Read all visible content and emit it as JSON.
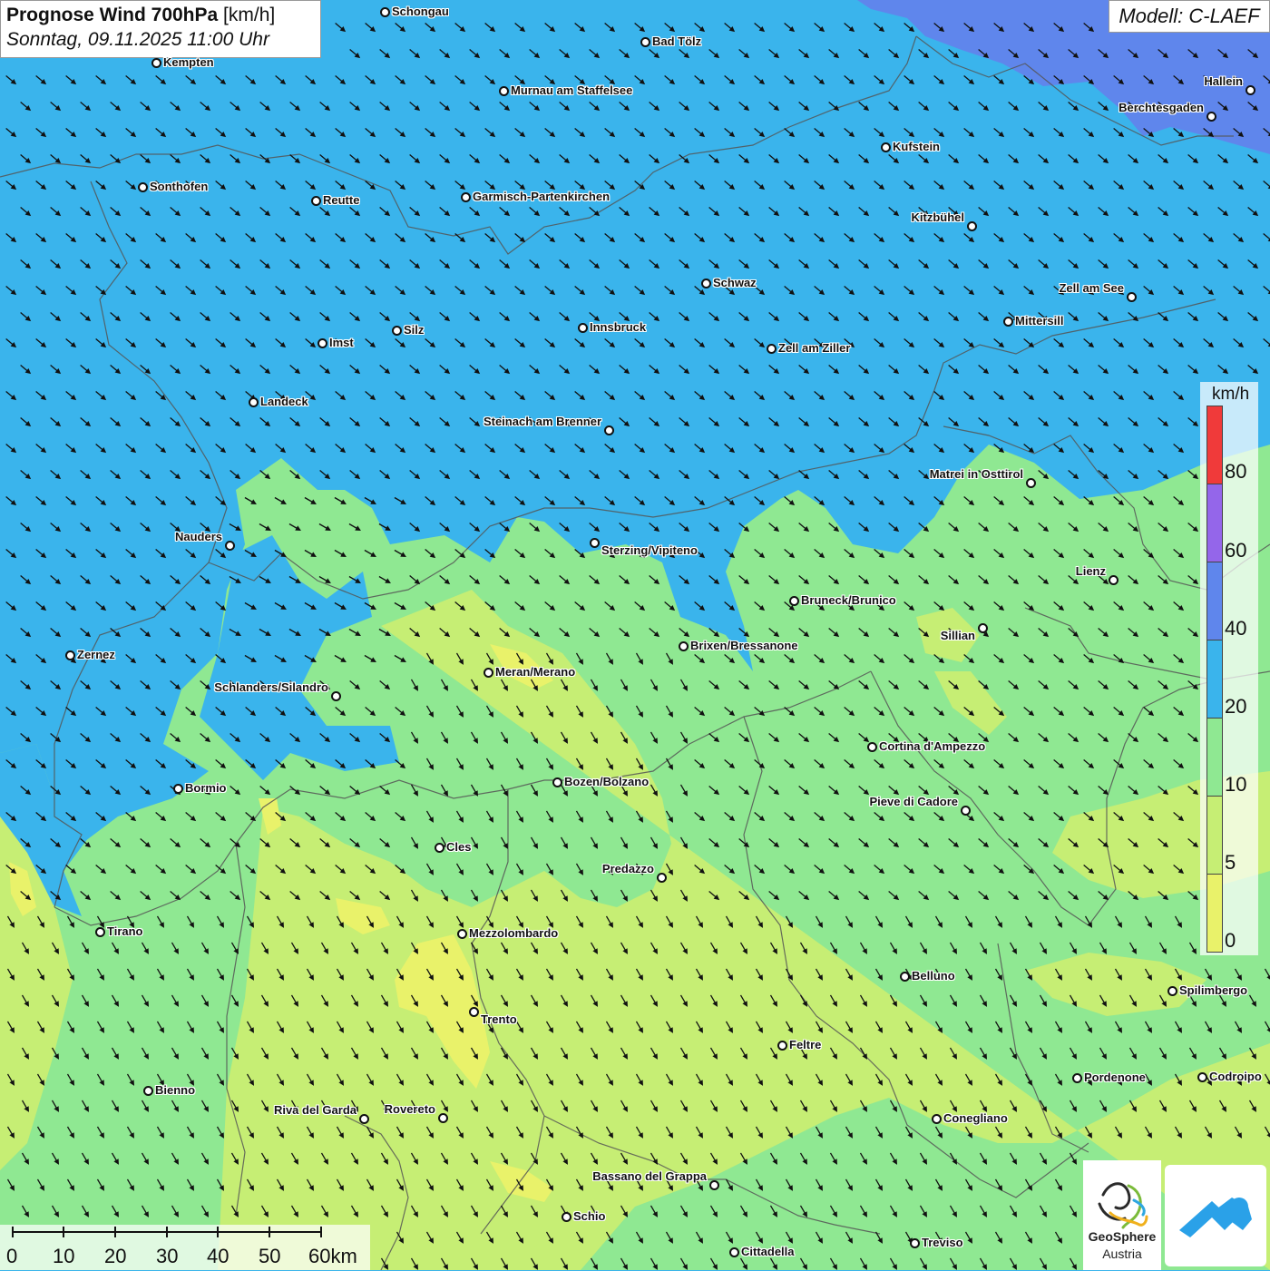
{
  "header": {
    "title_bold": "Prognose Wind 700hPa",
    "title_unit": "[km/h]",
    "datetime": "Sonntag, 09.11.2025 11:00 Uhr",
    "model": "Modell: C-LAEF"
  },
  "colors": {
    "wind_0_5": "#e9f26a",
    "wind_5_10": "#c6ee74",
    "wind_10_20": "#8fe892",
    "wind_20_40": "#3ab4ec",
    "wind_40_60": "#5f86ec",
    "wind_60_80": "#9466ea",
    "wind_80_plus": "#f03a3a",
    "arrow": "#111111",
    "borders": "#555555"
  },
  "legend": {
    "unit": "km/h",
    "ticks": [
      "80",
      "60",
      "40",
      "20",
      "10",
      "5",
      "0"
    ]
  },
  "scale_bar": {
    "labels": [
      "0",
      "10",
      "20",
      "30",
      "40",
      "50",
      "60km"
    ]
  },
  "arrow_field": {
    "direction": "north-west wind, arrows pointing south-east"
  },
  "cities": [
    {
      "name": "Schongau"
    },
    {
      "name": "Bad Tölz"
    },
    {
      "name": "Kempten"
    },
    {
      "name": "Murnau am Staffelsee"
    },
    {
      "name": "Hallein"
    },
    {
      "name": "Berchtesgaden"
    },
    {
      "name": "Kufstein"
    },
    {
      "name": "Sonthofen"
    },
    {
      "name": "Reutte"
    },
    {
      "name": "Garmisch-Partenkirchen"
    },
    {
      "name": "Kitzbühel"
    },
    {
      "name": "Schwaz"
    },
    {
      "name": "Zell am See"
    },
    {
      "name": "Innsbruck"
    },
    {
      "name": "Mittersill"
    },
    {
      "name": "Silz"
    },
    {
      "name": "Imst"
    },
    {
      "name": "Zell am Ziller"
    },
    {
      "name": "Landeck"
    },
    {
      "name": "Steinach am Brenner"
    },
    {
      "name": "Matrei in Osttirol"
    },
    {
      "name": "Nauders"
    },
    {
      "name": "Sterzing/Vipiteno"
    },
    {
      "name": "Lienz"
    },
    {
      "name": "Bruneck/Brunico"
    },
    {
      "name": "Sillian"
    },
    {
      "name": "Brixen/Bressanone"
    },
    {
      "name": "Zernez"
    },
    {
      "name": "Meran/Merano"
    },
    {
      "name": "Schlanders/Silandro"
    },
    {
      "name": "Cortina d'Ampezzo"
    },
    {
      "name": "Bozen/Bolzano"
    },
    {
      "name": "Bormio"
    },
    {
      "name": "Pieve di Cadore"
    },
    {
      "name": "Cles"
    },
    {
      "name": "Predazzo"
    },
    {
      "name": "Tirano"
    },
    {
      "name": "Mezzolombardo"
    },
    {
      "name": "Belluno"
    },
    {
      "name": "Spilimbergo"
    },
    {
      "name": "Trento"
    },
    {
      "name": "Feltre"
    },
    {
      "name": "Bienno"
    },
    {
      "name": "Pordenone"
    },
    {
      "name": "Codroipo"
    },
    {
      "name": "Riva del Garda"
    },
    {
      "name": "Rovereto"
    },
    {
      "name": "Conegliano"
    },
    {
      "name": "Bassano del Grappa"
    },
    {
      "name": "Schio"
    },
    {
      "name": "Treviso"
    },
    {
      "name": "Cittadella"
    }
  ],
  "logos": {
    "geosphere_line1": "GeoSphere",
    "geosphere_line2": "Austria"
  }
}
